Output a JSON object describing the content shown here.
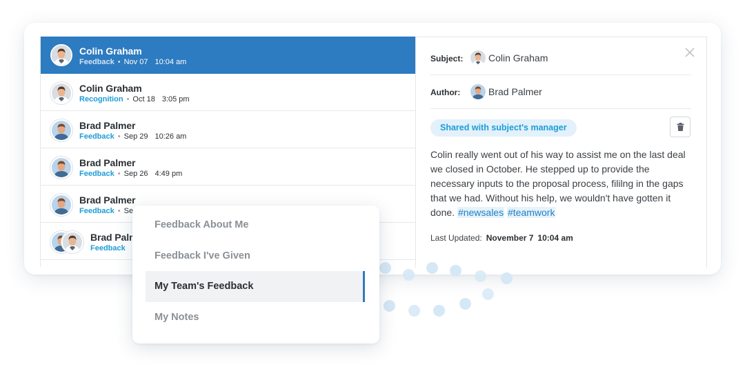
{
  "list": {
    "items": [
      {
        "name": "Colin Graham",
        "type": "Feedback",
        "date": "Nov 07",
        "time": "10:04 am",
        "avatar": "colin-avatar"
      },
      {
        "name": "Colin Graham",
        "type": "Recognition",
        "date": "Oct 18",
        "time": "3:05 pm",
        "avatar": "colin-avatar"
      },
      {
        "name": "Brad Palmer",
        "type": "Feedback",
        "date": "Sep 29",
        "time": "10:26 am",
        "avatar": "brad-avatar"
      },
      {
        "name": "Brad Palmer",
        "type": "Feedback",
        "date": "Sep 26",
        "time": "4:49 pm",
        "avatar": "brad-avatar"
      },
      {
        "name": "Brad Palmer",
        "type": "Feedback",
        "date": "Sep",
        "time": "",
        "avatar": "brad-avatar"
      },
      {
        "name": "Brad Palm",
        "type": "Feedback",
        "date": "",
        "time": "",
        "avatar": "group-avatar"
      }
    ]
  },
  "detail": {
    "subject_label": "Subject:",
    "subject_name": "Colin Graham",
    "author_label": "Author:",
    "author_name": "Brad Palmer",
    "badge": "Shared with subject's manager",
    "body": "Colin really went out of his way to assist me on the last deal we closed in October. He stepped up to provide the necessary inputs to the proposal process, fililng in the gaps that we had. Without his help, we wouldn't have gotten it done.",
    "tags": [
      "#newsales",
      "#teamwork"
    ],
    "updated_label": "Last Updated:",
    "updated_date": "November 7",
    "updated_time": "10:04 am",
    "icons": {
      "close": "close-icon",
      "delete": "trash-icon"
    }
  },
  "menu": {
    "items": [
      {
        "label": "Feedback About Me",
        "active": false
      },
      {
        "label": "Feedback I've Given",
        "active": false
      },
      {
        "label": "My Team's Feedback",
        "active": true
      },
      {
        "label": "My Notes",
        "active": false
      }
    ]
  },
  "colors": {
    "accent": "#2d7bc0",
    "link": "#1d9dd5",
    "badge_bg": "#e2f1fb"
  }
}
